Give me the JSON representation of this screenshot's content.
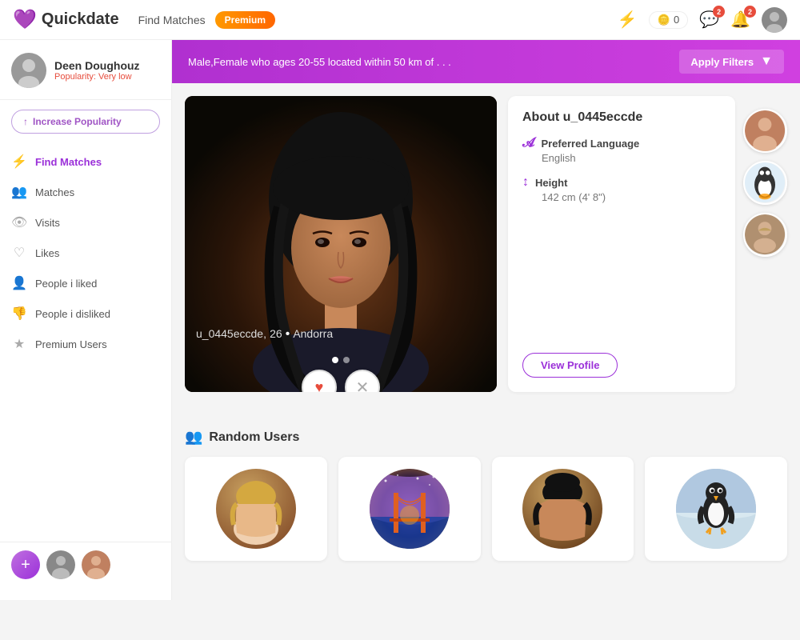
{
  "topbar": {
    "logo_text": "Quickdate",
    "nav_find_matches": "Find Matches",
    "premium_label": "Premium",
    "coins_count": "0",
    "notif_badge": "2",
    "alert_badge": "2"
  },
  "sidebar": {
    "user_name": "Deen Doughouz",
    "user_popularity_label": "Popularity:",
    "user_popularity_value": "Very low",
    "increase_btn": "Increase Popularity",
    "nav_items": [
      {
        "id": "find-matches",
        "label": "Find Matches",
        "icon": "⚡",
        "active": true
      },
      {
        "id": "matches",
        "label": "Matches",
        "icon": "👥",
        "active": false
      },
      {
        "id": "visits",
        "label": "Visits",
        "icon": "👁",
        "active": false
      },
      {
        "id": "likes",
        "label": "Likes",
        "icon": "♡",
        "active": false
      },
      {
        "id": "people-liked",
        "label": "People i liked",
        "icon": "👤",
        "active": false
      },
      {
        "id": "people-disliked",
        "label": "People i disliked",
        "icon": "👎",
        "active": false
      },
      {
        "id": "premium-users",
        "label": "Premium Users",
        "icon": "★",
        "active": false
      }
    ]
  },
  "filter_bar": {
    "text": "Male,Female who ages 20-55 located within 50 km of . . .",
    "apply_label": "Apply Filters"
  },
  "profile": {
    "username": "u_0445eccde,",
    "age": "26",
    "location": "Andorra",
    "about_title": "About u_0445eccde",
    "language_label": "Preferred Language",
    "language_value": "English",
    "height_label": "Height",
    "height_value": "142 cm (4' 8\")",
    "view_profile_btn": "View Profile"
  },
  "action_buttons": {
    "like_label": "♥",
    "dislike_label": "✕"
  },
  "random_section": {
    "title": "Random Users"
  },
  "random_users": [
    {
      "id": 1,
      "color_class": "rc1"
    },
    {
      "id": 2,
      "color_class": "rc2"
    },
    {
      "id": 3,
      "color_class": "rc3"
    },
    {
      "id": 4,
      "color_class": "rc4"
    }
  ]
}
